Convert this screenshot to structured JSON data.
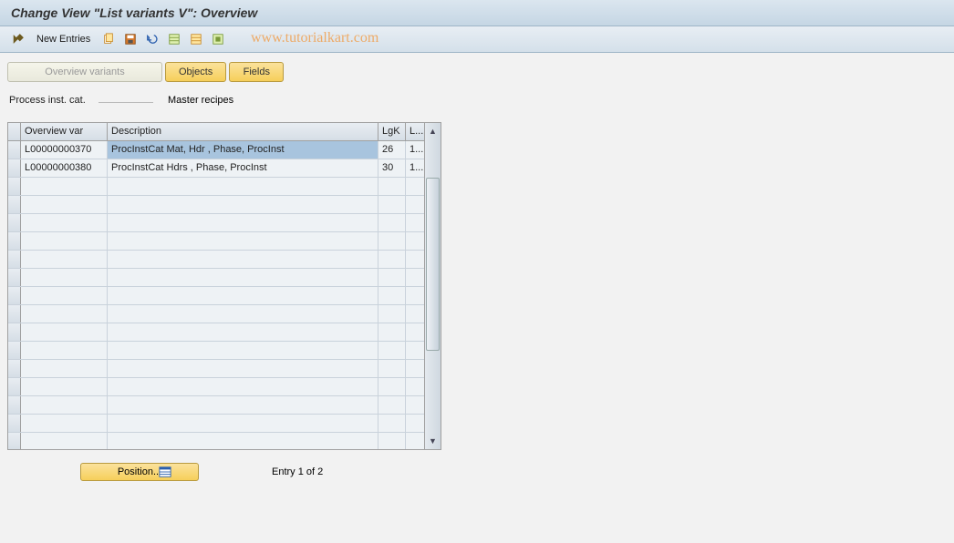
{
  "title": "Change View \"List variants                     V\": Overview",
  "toolbar": {
    "new_entries": "New Entries"
  },
  "watermark": "www.tutorialkart.com",
  "tabs": {
    "overview": "Overview variants",
    "objects": "Objects",
    "fields": "Fields"
  },
  "header_fields": {
    "label": "Process inst. cat.",
    "value": "",
    "text": "Master recipes"
  },
  "grid": {
    "columns": {
      "c1": "Overview var",
      "c2": "Description",
      "c3": "LgK",
      "c4": "L..."
    },
    "rows": [
      {
        "c1": "L00000000370",
        "c2": "ProcInstCat  Mat, Hdr , Phase, ProcInst",
        "c3": "26",
        "c4": "1..."
      },
      {
        "c1": "L00000000380",
        "c2": "ProcInstCat  Hdrs , Phase, ProcInst",
        "c3": "30",
        "c4": "1..."
      }
    ]
  },
  "footer": {
    "position": "Position...",
    "entry": "Entry 1 of 2"
  }
}
